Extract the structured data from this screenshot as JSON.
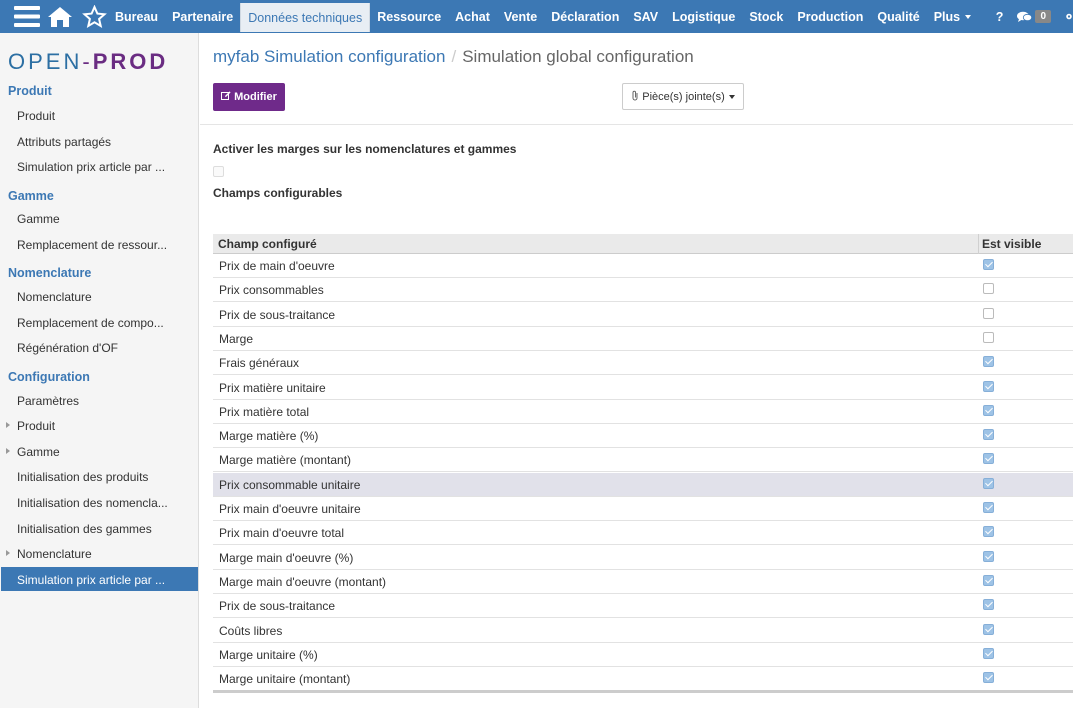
{
  "navbar": {
    "icons": [
      "menu-icon",
      "home-icon",
      "star-icon"
    ],
    "items": [
      {
        "label": "Bureau"
      },
      {
        "label": "Partenaire"
      },
      {
        "label": "Données techniques",
        "active": true
      },
      {
        "label": "Ressource"
      },
      {
        "label": "Achat"
      },
      {
        "label": "Vente"
      },
      {
        "label": "Déclaration"
      },
      {
        "label": "SAV"
      },
      {
        "label": "Logistique"
      },
      {
        "label": "Stock"
      },
      {
        "label": "Production"
      },
      {
        "label": "Qualité"
      },
      {
        "label": "Plus"
      }
    ],
    "help_label": "?",
    "chat_count": "0",
    "colors": {
      "bar": "#3c78b4",
      "active_bg": "#e8eef4"
    }
  },
  "logo": {
    "open": "OPEN",
    "dash": "-",
    "prod": "PROD"
  },
  "sidebar": {
    "sections": [
      {
        "title": "Produit",
        "items": [
          "Produit",
          "Attributs partagés",
          "Simulation prix article par ..."
        ]
      },
      {
        "title": "Gamme",
        "items": [
          "Gamme",
          "Remplacement de ressour..."
        ]
      },
      {
        "title": "Nomenclature",
        "items": [
          "Nomenclature",
          "Remplacement de compo...",
          "Régénération d'OF"
        ]
      },
      {
        "title": "Configuration",
        "items": [
          "Paramètres",
          "Produit",
          "Gamme",
          "Initialisation des produits",
          "Initialisation des nomencla...",
          "Initialisation des gammes",
          "Nomenclature",
          "Simulation prix article par ..."
        ]
      }
    ],
    "active_item": "Simulation prix article par ..."
  },
  "breadcrumb": {
    "parent": "myfab Simulation configuration",
    "current": "Simulation global configuration"
  },
  "toolbar": {
    "edit_label": "Modifier",
    "attachments_label": "Pièce(s) jointe(s)"
  },
  "form": {
    "margins_label": "Activer les marges sur les nomenclatures et gammes",
    "margins_checked": false,
    "fields_label": "Champs configurables"
  },
  "table": {
    "columns": [
      "Champ configuré",
      "Est visible"
    ],
    "rows": [
      {
        "name": "Prix de main d'oeuvre",
        "visible": true
      },
      {
        "name": "Prix consommables",
        "visible": false
      },
      {
        "name": "Prix de sous-traitance",
        "visible": false
      },
      {
        "name": "Marge",
        "visible": false
      },
      {
        "name": "Frais généraux",
        "visible": true
      },
      {
        "name": "Prix matière unitaire",
        "visible": true
      },
      {
        "name": "Prix matière total",
        "visible": true
      },
      {
        "name": "Marge matière (%)",
        "visible": true
      },
      {
        "name": "Marge matière (montant)",
        "visible": true
      },
      {
        "name": "Prix consommable unitaire",
        "visible": true
      },
      {
        "name": "Prix main d'oeuvre unitaire",
        "visible": true
      },
      {
        "name": "Prix main d'oeuvre total",
        "visible": true
      },
      {
        "name": "Marge main d'oeuvre (%)",
        "visible": true
      },
      {
        "name": "Marge main d'oeuvre (montant)",
        "visible": true
      },
      {
        "name": "Prix de sous-traitance",
        "visible": true
      },
      {
        "name": "Coûts libres",
        "visible": true
      },
      {
        "name": "Marge unitaire (%)",
        "visible": true
      },
      {
        "name": "Marge unitaire (montant)",
        "visible": true
      }
    ],
    "highlighted_row": "Prix consommable unitaire"
  },
  "colors": {
    "primary": "#3c78b4",
    "brand_purple": "#6f2a8a",
    "check_blue": "#9ec3e6"
  }
}
